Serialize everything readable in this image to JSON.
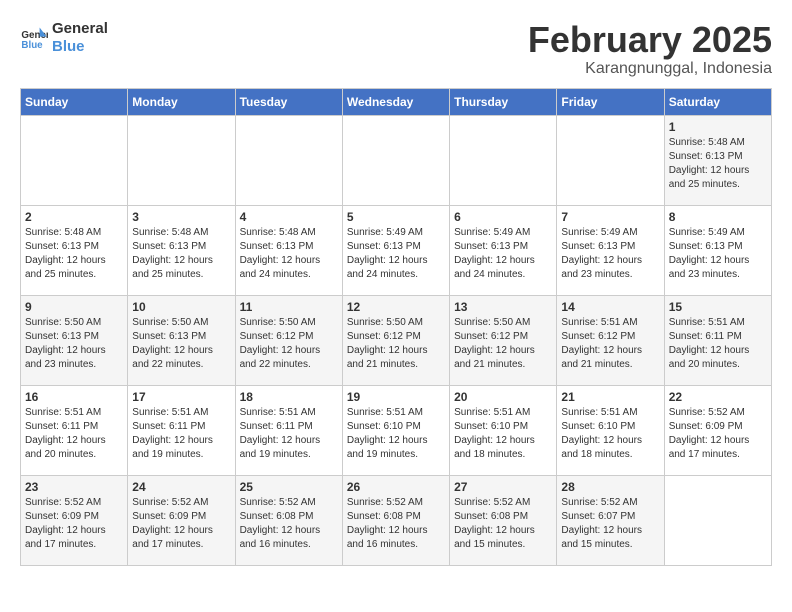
{
  "logo": {
    "line1": "General",
    "line2": "Blue"
  },
  "title": {
    "month_year": "February 2025",
    "location": "Karangnunggal, Indonesia"
  },
  "weekdays": [
    "Sunday",
    "Monday",
    "Tuesday",
    "Wednesday",
    "Thursday",
    "Friday",
    "Saturday"
  ],
  "weeks": [
    [
      {
        "day": "",
        "info": ""
      },
      {
        "day": "",
        "info": ""
      },
      {
        "day": "",
        "info": ""
      },
      {
        "day": "",
        "info": ""
      },
      {
        "day": "",
        "info": ""
      },
      {
        "day": "",
        "info": ""
      },
      {
        "day": "1",
        "info": "Sunrise: 5:48 AM\nSunset: 6:13 PM\nDaylight: 12 hours\nand 25 minutes."
      }
    ],
    [
      {
        "day": "2",
        "info": "Sunrise: 5:48 AM\nSunset: 6:13 PM\nDaylight: 12 hours\nand 25 minutes."
      },
      {
        "day": "3",
        "info": "Sunrise: 5:48 AM\nSunset: 6:13 PM\nDaylight: 12 hours\nand 25 minutes."
      },
      {
        "day": "4",
        "info": "Sunrise: 5:48 AM\nSunset: 6:13 PM\nDaylight: 12 hours\nand 24 minutes."
      },
      {
        "day": "5",
        "info": "Sunrise: 5:49 AM\nSunset: 6:13 PM\nDaylight: 12 hours\nand 24 minutes."
      },
      {
        "day": "6",
        "info": "Sunrise: 5:49 AM\nSunset: 6:13 PM\nDaylight: 12 hours\nand 24 minutes."
      },
      {
        "day": "7",
        "info": "Sunrise: 5:49 AM\nSunset: 6:13 PM\nDaylight: 12 hours\nand 23 minutes."
      },
      {
        "day": "8",
        "info": "Sunrise: 5:49 AM\nSunset: 6:13 PM\nDaylight: 12 hours\nand 23 minutes."
      }
    ],
    [
      {
        "day": "9",
        "info": "Sunrise: 5:50 AM\nSunset: 6:13 PM\nDaylight: 12 hours\nand 23 minutes."
      },
      {
        "day": "10",
        "info": "Sunrise: 5:50 AM\nSunset: 6:13 PM\nDaylight: 12 hours\nand 22 minutes."
      },
      {
        "day": "11",
        "info": "Sunrise: 5:50 AM\nSunset: 6:12 PM\nDaylight: 12 hours\nand 22 minutes."
      },
      {
        "day": "12",
        "info": "Sunrise: 5:50 AM\nSunset: 6:12 PM\nDaylight: 12 hours\nand 21 minutes."
      },
      {
        "day": "13",
        "info": "Sunrise: 5:50 AM\nSunset: 6:12 PM\nDaylight: 12 hours\nand 21 minutes."
      },
      {
        "day": "14",
        "info": "Sunrise: 5:51 AM\nSunset: 6:12 PM\nDaylight: 12 hours\nand 21 minutes."
      },
      {
        "day": "15",
        "info": "Sunrise: 5:51 AM\nSunset: 6:11 PM\nDaylight: 12 hours\nand 20 minutes."
      }
    ],
    [
      {
        "day": "16",
        "info": "Sunrise: 5:51 AM\nSunset: 6:11 PM\nDaylight: 12 hours\nand 20 minutes."
      },
      {
        "day": "17",
        "info": "Sunrise: 5:51 AM\nSunset: 6:11 PM\nDaylight: 12 hours\nand 19 minutes."
      },
      {
        "day": "18",
        "info": "Sunrise: 5:51 AM\nSunset: 6:11 PM\nDaylight: 12 hours\nand 19 minutes."
      },
      {
        "day": "19",
        "info": "Sunrise: 5:51 AM\nSunset: 6:10 PM\nDaylight: 12 hours\nand 19 minutes."
      },
      {
        "day": "20",
        "info": "Sunrise: 5:51 AM\nSunset: 6:10 PM\nDaylight: 12 hours\nand 18 minutes."
      },
      {
        "day": "21",
        "info": "Sunrise: 5:51 AM\nSunset: 6:10 PM\nDaylight: 12 hours\nand 18 minutes."
      },
      {
        "day": "22",
        "info": "Sunrise: 5:52 AM\nSunset: 6:09 PM\nDaylight: 12 hours\nand 17 minutes."
      }
    ],
    [
      {
        "day": "23",
        "info": "Sunrise: 5:52 AM\nSunset: 6:09 PM\nDaylight: 12 hours\nand 17 minutes."
      },
      {
        "day": "24",
        "info": "Sunrise: 5:52 AM\nSunset: 6:09 PM\nDaylight: 12 hours\nand 17 minutes."
      },
      {
        "day": "25",
        "info": "Sunrise: 5:52 AM\nSunset: 6:08 PM\nDaylight: 12 hours\nand 16 minutes."
      },
      {
        "day": "26",
        "info": "Sunrise: 5:52 AM\nSunset: 6:08 PM\nDaylight: 12 hours\nand 16 minutes."
      },
      {
        "day": "27",
        "info": "Sunrise: 5:52 AM\nSunset: 6:08 PM\nDaylight: 12 hours\nand 15 minutes."
      },
      {
        "day": "28",
        "info": "Sunrise: 5:52 AM\nSunset: 6:07 PM\nDaylight: 12 hours\nand 15 minutes."
      },
      {
        "day": "",
        "info": ""
      }
    ]
  ]
}
